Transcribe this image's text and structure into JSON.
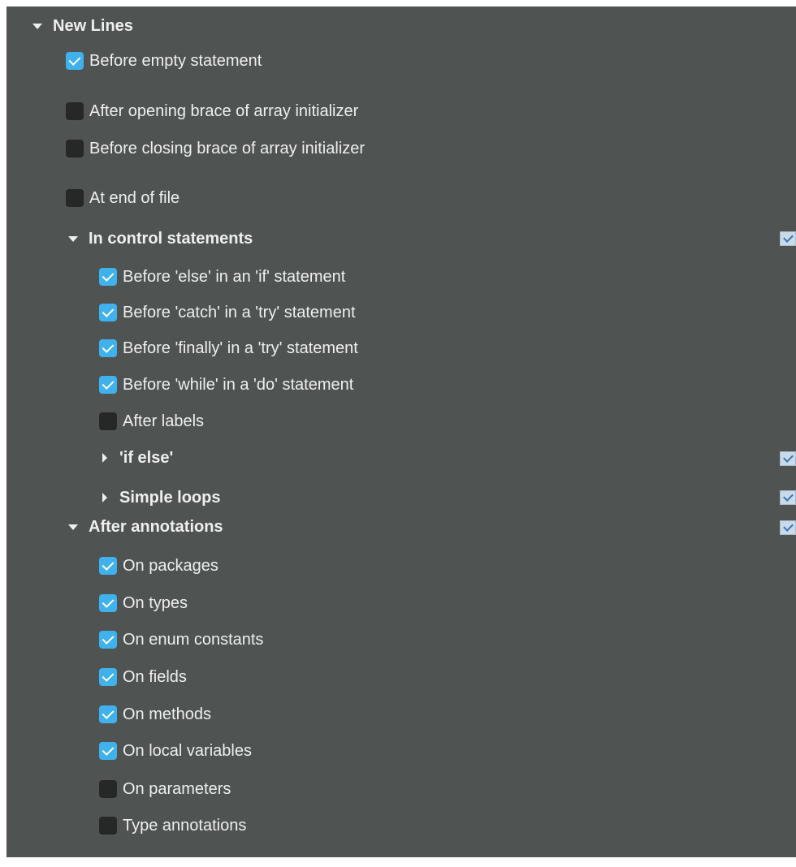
{
  "new_lines": {
    "title": "New Lines",
    "items": [
      {
        "label": "Before empty statement",
        "checked": true
      },
      {
        "label": "After opening brace of array initializer",
        "checked": false
      },
      {
        "label": "Before closing brace of array initializer",
        "checked": false
      },
      {
        "label": "At end of file",
        "checked": false
      }
    ]
  },
  "control_statements": {
    "title": "In control statements",
    "group_checked": true,
    "items": [
      {
        "label": "Before 'else' in an 'if' statement",
        "checked": true
      },
      {
        "label": "Before 'catch' in a 'try' statement",
        "checked": true
      },
      {
        "label": "Before 'finally' in a 'try' statement",
        "checked": true
      },
      {
        "label": "Before 'while' in a 'do' statement",
        "checked": true
      },
      {
        "label": "After labels",
        "checked": false
      }
    ],
    "subgroups": [
      {
        "title": "'if else'",
        "expanded": false,
        "group_checked": true
      },
      {
        "title": "Simple loops",
        "expanded": false,
        "group_checked": true
      }
    ]
  },
  "annotations": {
    "title": "After annotations",
    "group_checked": true,
    "items": [
      {
        "label": "On packages",
        "checked": true
      },
      {
        "label": "On types",
        "checked": true
      },
      {
        "label": "On enum constants",
        "checked": true
      },
      {
        "label": "On fields",
        "checked": true
      },
      {
        "label": "On methods",
        "checked": true
      },
      {
        "label": "On local variables",
        "checked": true
      },
      {
        "label": "On parameters",
        "checked": false
      },
      {
        "label": "Type annotations",
        "checked": false
      }
    ]
  },
  "colors": {
    "panel_background": "#4f5352",
    "checkbox_checked": "#3fb1ec",
    "checkbox_unchecked": "#262828",
    "text": "#eef0f0"
  },
  "icons": {
    "expanded": "caret-down-icon",
    "collapsed": "caret-right-icon",
    "group_state": "group-checkbox-icon"
  }
}
